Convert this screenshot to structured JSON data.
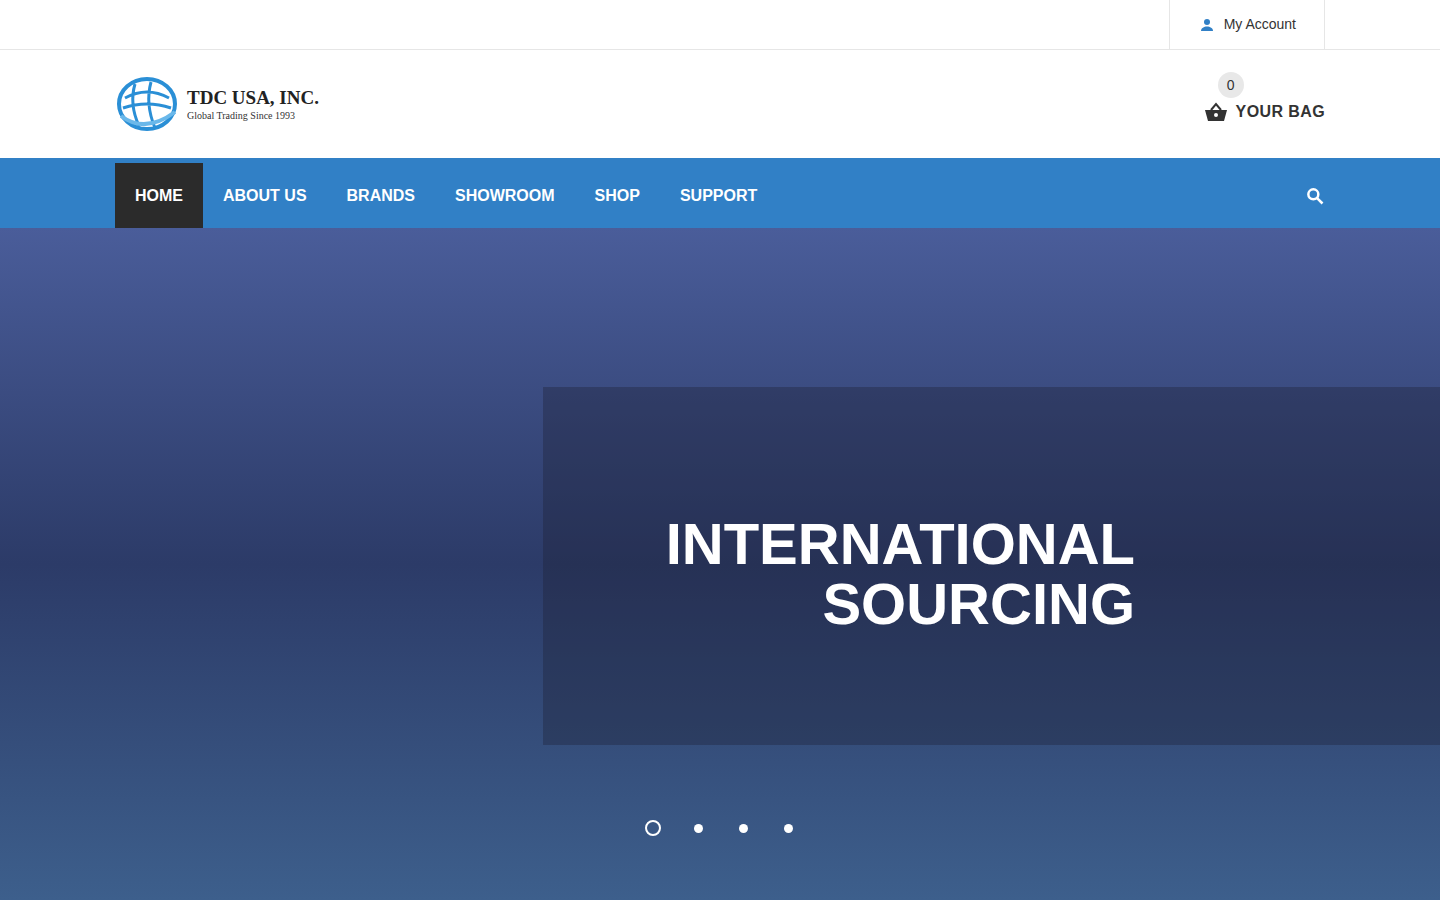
{
  "top_bar": {
    "account": "My Account"
  },
  "logo": {
    "name": "TDC USA, INC.",
    "tagline": "Global Trading Since 1993"
  },
  "cart": {
    "count": "0",
    "label": "YOUR BAG"
  },
  "nav": [
    {
      "label": "HOME",
      "selected": true
    },
    {
      "label": "ABOUT US",
      "selected": false
    },
    {
      "label": "BRANDS",
      "selected": false
    },
    {
      "label": "SHOWROOM",
      "selected": false
    },
    {
      "label": "SHOP",
      "selected": false
    },
    {
      "label": "SUPPORT",
      "selected": false
    }
  ],
  "hero": {
    "headline": [
      "INTERNATIONAL",
      "SOURCING"
    ],
    "slides": [
      {
        "selected": true
      },
      {
        "selected": false
      },
      {
        "selected": false
      },
      {
        "selected": false
      }
    ]
  }
}
